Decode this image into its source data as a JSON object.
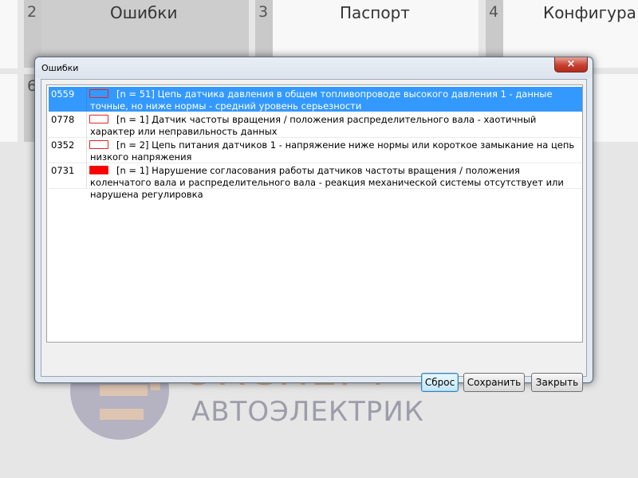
{
  "background_tiles": [
    {
      "number": "2",
      "label": "Ошибки"
    },
    {
      "number": "3",
      "label": "Паспорт"
    },
    {
      "number": "4",
      "label": "Конфигура"
    },
    {
      "number": "6",
      "label": ""
    }
  ],
  "dialog": {
    "title": "Ошибки",
    "close_icon": "×",
    "errors": [
      {
        "code": "0559",
        "swatch": "#3399ff",
        "swatch_border": "#e52424",
        "selected": true,
        "text": "[n = 51] Цепь датчика давления в общем топливопроводе высокого давления 1 - данные точные, но ниже нормы - средний уровень серьезности"
      },
      {
        "code": "0778",
        "swatch": "#ffffff",
        "swatch_border": "#e52424",
        "selected": false,
        "text": "[n = 1] Датчик частоты вращения / положения распределительного вала - хаотичный характер или неправильность данных"
      },
      {
        "code": "0352",
        "swatch": "#ffffff",
        "swatch_border": "#e52424",
        "selected": false,
        "text": "[n = 2] Цепь питания датчиков 1 - напряжение ниже нормы или короткое замыкание на цепь низкого напряжения"
      },
      {
        "code": "0731",
        "swatch": "#ff0000",
        "swatch_border": "#e52424",
        "selected": false,
        "text": "[n = 1] Нарушение согласования работы датчиков частоты вращения / положения коленчатого вала и распределительного вала - реакция механической системы отсутствует или нарушена регулировка"
      }
    ],
    "buttons": {
      "reset": "Сброс",
      "save": "Сохранить",
      "close": "Закрыть"
    }
  },
  "watermark": {
    "line1": "ЭКСПЕРТ",
    "line2": "АВТОЭЛЕКТРИК"
  },
  "colors": {
    "selection": "#3399ff",
    "error_red": "#ff0000",
    "logo_tan": "#d1a47b",
    "logo_purple": "#8b8b9c"
  }
}
